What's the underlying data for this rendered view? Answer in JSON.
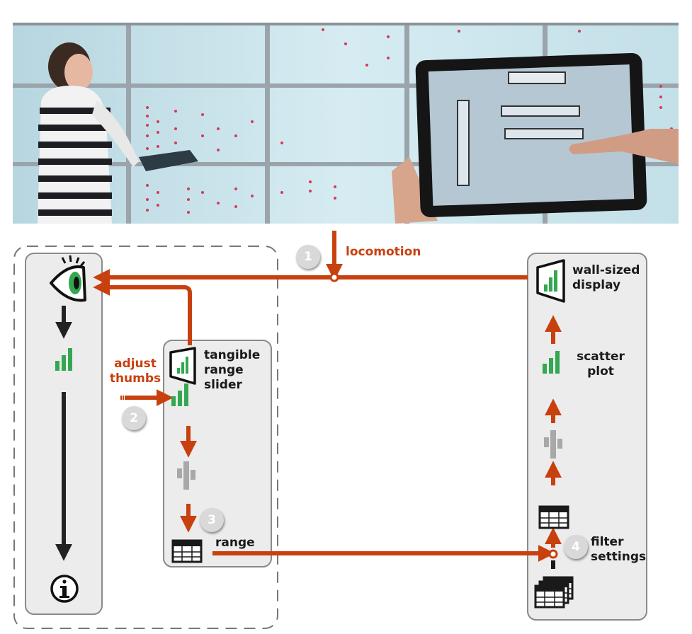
{
  "steps": [
    {
      "number": "1",
      "label": "locomotion"
    },
    {
      "number": "2",
      "label": "adjust thumbs"
    },
    {
      "number": "3",
      "label": "range"
    },
    {
      "number": "4",
      "label": "filter settings"
    }
  ],
  "nodes": {
    "tangible": "tangible range slider",
    "wall": "wall-sized display",
    "scatter": "scatter plot"
  },
  "icons": [
    "eye-icon",
    "bar-chart-icon",
    "info-icon",
    "wall-display-icon",
    "table-icon",
    "stacked-tables-icon",
    "glyph-filter-icon"
  ],
  "colors": {
    "flow_arrow": "#c8400e",
    "pipeline_arrow": "#222222",
    "bars": "#33a852",
    "glyph": "#a8a8a8",
    "panel": "#ececec",
    "wall_screen": "#c8e4ee"
  }
}
